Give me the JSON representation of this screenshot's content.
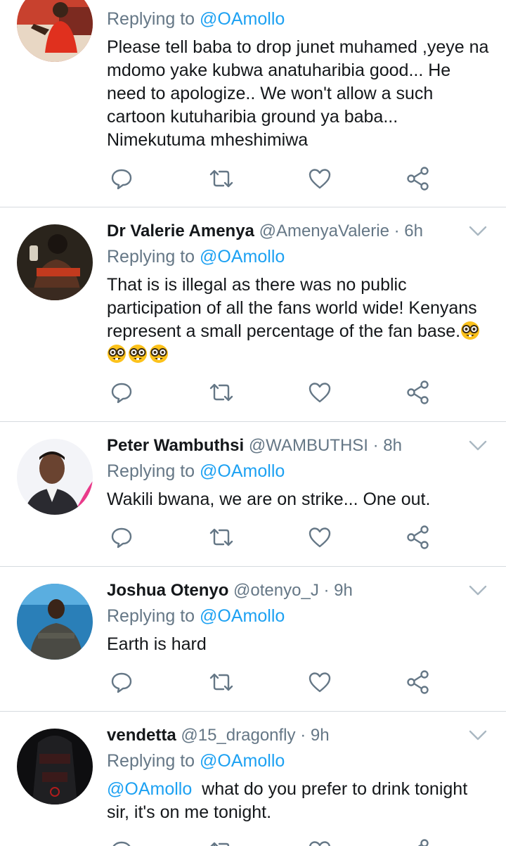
{
  "reply_prefix": "Replying to",
  "tweets": [
    {
      "reply_to": "@OAmollo",
      "text": "Please tell baba to drop junet muhamed ,yeye na mdomo yake kubwa anatuharibia good... He need to apologize..  We won't allow a such cartoon kutuharibia ground ya baba... Nimekutuma mheshimiwa"
    },
    {
      "name": "Dr Valerie Amenya",
      "handle": "@AmenyaValerie",
      "dot": "·",
      "time": "6h",
      "reply_to": "@OAmollo",
      "text": "That is is illegal as there was no public participation of  all the fans world wide! Kenyans represent a small percentage of the fan base.",
      "emoji": "nerd-face-emoji"
    },
    {
      "name": "Peter Wambuthsi",
      "handle": "@WAMBUTHSI",
      "dot": "·",
      "time": "8h",
      "reply_to": "@OAmollo",
      "text": "Wakili bwana, we are on strike... One out."
    },
    {
      "name": "Joshua Otenyo",
      "handle": "@otenyo_J",
      "dot": "·",
      "time": "9h",
      "reply_to": "@OAmollo",
      "text": "Earth is hard"
    },
    {
      "name": "vendetta",
      "handle": "@15_dragonfly",
      "dot": "·",
      "time": "9h",
      "reply_to": "@OAmollo",
      "text_mention": "@OAmollo",
      "text": "  what do you prefer to drink tonight sir, it's on me tonight."
    }
  ],
  "icons": {
    "reply": "reply-icon",
    "retweet": "retweet-icon",
    "like": "heart-icon",
    "share": "share-icon",
    "menu": "chevron-down-icon"
  },
  "colors": {
    "text": "#14171a",
    "muted": "#657786",
    "accent": "#1da1f2",
    "divider": "#d6dbdf"
  }
}
